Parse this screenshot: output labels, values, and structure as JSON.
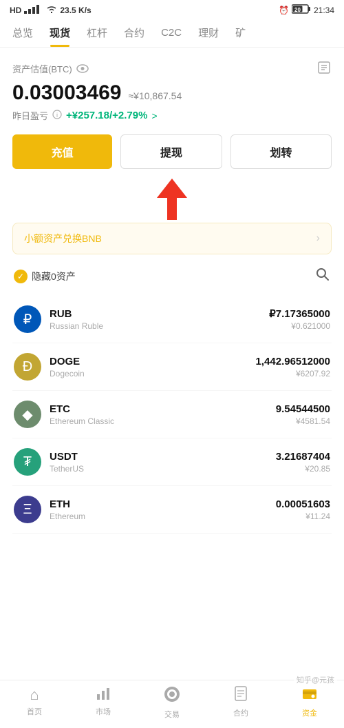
{
  "statusBar": {
    "left": "HD  26  46",
    "speed": "23.5 K/s",
    "time": "21:34"
  },
  "navTabs": {
    "items": [
      {
        "label": "总览",
        "active": false
      },
      {
        "label": "现货",
        "active": true
      },
      {
        "label": "杠杆",
        "active": false
      },
      {
        "label": "合约",
        "active": false
      },
      {
        "label": "C2C",
        "active": false
      },
      {
        "label": "理财",
        "active": false
      },
      {
        "label": "矿",
        "active": false
      }
    ]
  },
  "assetSection": {
    "label": "资产估值(BTC)",
    "btcValue": "0.03003469",
    "cnyApprox": "≈¥10,867.54",
    "profitLabel": "昨日盈亏",
    "profitValue": "+¥257.18/+2.79%",
    "profitArrow": ">"
  },
  "buttons": {
    "recharge": "充值",
    "withdraw": "提现",
    "transfer": "划转"
  },
  "bnbBanner": {
    "text": "小额资产兑换BNB",
    "arrow": "›"
  },
  "hideAssets": {
    "label": "隐藏0资产"
  },
  "coins": [
    {
      "symbol": "RUB",
      "name": "Russian Ruble",
      "amount": "₽7.17365000",
      "cny": "¥0.621000",
      "iconType": "rub",
      "iconChar": "₽"
    },
    {
      "symbol": "DOGE",
      "name": "Dogecoin",
      "amount": "1,442.96512000",
      "cny": "¥6207.92",
      "iconType": "doge",
      "iconChar": "Ð"
    },
    {
      "symbol": "ETC",
      "name": "Ethereum Classic",
      "amount": "9.54544500",
      "cny": "¥4581.54",
      "iconType": "etc",
      "iconChar": "◆"
    },
    {
      "symbol": "USDT",
      "name": "TetherUS",
      "amount": "3.21687404",
      "cny": "¥20.85",
      "iconType": "usdt",
      "iconChar": "₮"
    },
    {
      "symbol": "ETH",
      "name": "Ethereum",
      "amount": "0.00051603",
      "cny": "¥11.24",
      "iconType": "eth",
      "iconChar": "Ξ"
    }
  ],
  "bottomNav": {
    "items": [
      {
        "label": "首页",
        "icon": "⌂",
        "active": false
      },
      {
        "label": "市场",
        "icon": "📊",
        "active": false
      },
      {
        "label": "交易",
        "icon": "🔄",
        "active": false
      },
      {
        "label": "合约",
        "icon": "📋",
        "active": false
      },
      {
        "label": "资金",
        "icon": "💰",
        "active": true
      }
    ]
  },
  "watermark": "知乎@元孩"
}
